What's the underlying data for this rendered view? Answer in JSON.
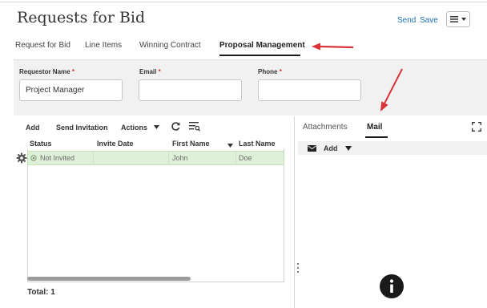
{
  "header": {
    "title": "Requests for Bid",
    "send_label": "Send",
    "save_label": "Save"
  },
  "tabs": [
    {
      "label": "Request for Bid"
    },
    {
      "label": "Line Items"
    },
    {
      "label": "Winning Contract"
    },
    {
      "label": "Proposal Management",
      "active": true
    }
  ],
  "form": {
    "requestor_label": "Requestor Name",
    "requestor_value": "Project Manager",
    "email_label": "Email",
    "email_value": "",
    "phone_label": "Phone",
    "phone_value": "",
    "required_marker": "*"
  },
  "invitees": {
    "toolbar": {
      "add": "Add",
      "send_invitation": "Send Invitation",
      "actions": "Actions"
    },
    "columns": [
      "Status",
      "Invite Date",
      "First Name",
      "Last Name"
    ],
    "rows": [
      {
        "status": "Not Invited",
        "invite_date": "",
        "first_name": "John",
        "last_name": "Doe"
      }
    ],
    "total_label": "Total: 1"
  },
  "side_panel": {
    "tabs": [
      {
        "label": "Attachments"
      },
      {
        "label": "Mail",
        "active": true
      }
    ],
    "mail_add": "Add"
  },
  "colors": {
    "link": "#1f6fb5",
    "required": "#d6362f",
    "selected_row": "#dff0d8",
    "annotation_arrow": "#d9343a"
  },
  "icons": [
    "menu-icon",
    "refresh-icon",
    "query-by-example-icon",
    "gear-icon",
    "envelope-icon",
    "expand-icon",
    "info-icon",
    "chevron-down-icon"
  ]
}
